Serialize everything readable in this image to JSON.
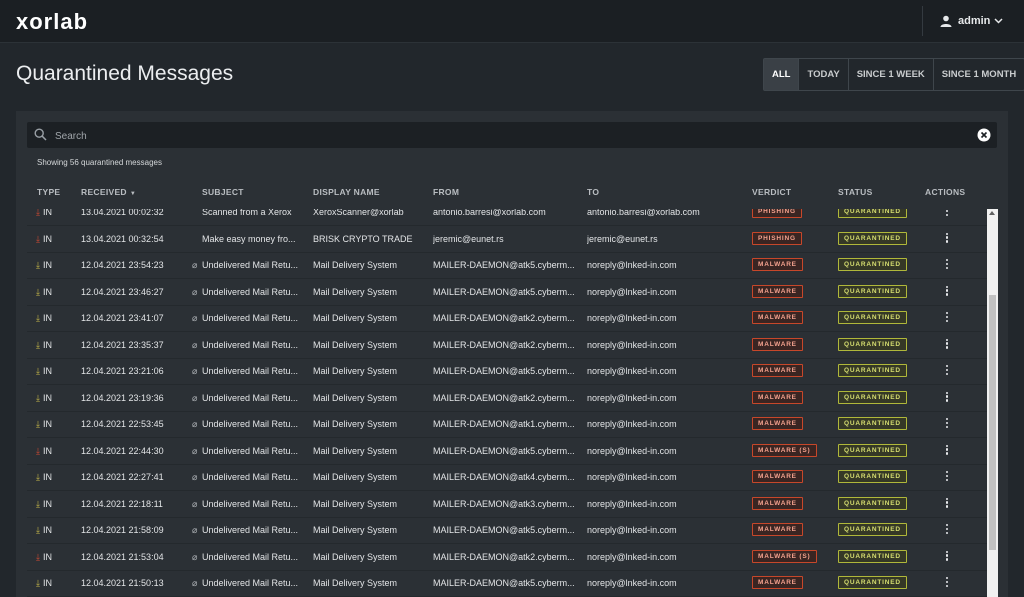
{
  "app": {
    "logo": "xorlab"
  },
  "user": {
    "name": "admin",
    "icon": "user-icon"
  },
  "page": {
    "title": "Quarantined Messages"
  },
  "filters": [
    {
      "label": "ALL",
      "active": true
    },
    {
      "label": "TODAY",
      "active": false
    },
    {
      "label": "SINCE 1 WEEK",
      "active": false
    },
    {
      "label": "SINCE 1 MONTH",
      "active": false
    }
  ],
  "search": {
    "placeholder": "Search",
    "value": ""
  },
  "summary": {
    "text": "Showing 56 quarantined messages"
  },
  "columns": {
    "type": "TYPE",
    "received": "RECEIVED",
    "subject": "SUBJECT",
    "display_name": "DISPLAY NAME",
    "from": "FROM",
    "to": "TO",
    "verdict": "VERDICT",
    "status": "STATUS",
    "actions": "ACTIONS"
  },
  "colors": {
    "arrow_yellow": "#c7b84a",
    "arrow_red": "#d04a32",
    "verdict_border": "#c7472a",
    "status_border": "#b0b83a"
  },
  "rows": [
    {
      "type": "IN",
      "arrow": "red",
      "received": "13.04.2021 00:02:32",
      "attach": false,
      "subject": "Scanned from a Xerox",
      "display_name": "XeroxScanner@xorlab",
      "from": "antonio.barresi@xorlab.com",
      "to": "antonio.barresi@xorlab.com",
      "verdict": "PHISHING",
      "status": "QUARANTINED"
    },
    {
      "type": "IN",
      "arrow": "red",
      "received": "13.04.2021 00:32:54",
      "attach": false,
      "subject": "Make easy money fro...",
      "display_name": "BRISK CRYPTO TRADE",
      "from": "jeremic@eunet.rs",
      "to": "jeremic@eunet.rs",
      "verdict": "PHISHING",
      "status": "QUARANTINED"
    },
    {
      "type": "IN",
      "arrow": "yellow",
      "received": "12.04.2021 23:54:23",
      "attach": true,
      "subject": "Undelivered Mail Retu...",
      "display_name": "Mail Delivery System",
      "from": "MAILER-DAEMON@atk5.cyberm...",
      "to": "noreply@lnked-in.com",
      "verdict": "MALWARE",
      "status": "QUARANTINED"
    },
    {
      "type": "IN",
      "arrow": "yellow",
      "received": "12.04.2021 23:46:27",
      "attach": true,
      "subject": "Undelivered Mail Retu...",
      "display_name": "Mail Delivery System",
      "from": "MAILER-DAEMON@atk5.cyberm...",
      "to": "noreply@lnked-in.com",
      "verdict": "MALWARE",
      "status": "QUARANTINED"
    },
    {
      "type": "IN",
      "arrow": "yellow",
      "received": "12.04.2021 23:41:07",
      "attach": true,
      "subject": "Undelivered Mail Retu...",
      "display_name": "Mail Delivery System",
      "from": "MAILER-DAEMON@atk2.cyberm...",
      "to": "noreply@lnked-in.com",
      "verdict": "MALWARE",
      "status": "QUARANTINED"
    },
    {
      "type": "IN",
      "arrow": "yellow",
      "received": "12.04.2021 23:35:37",
      "attach": true,
      "subject": "Undelivered Mail Retu...",
      "display_name": "Mail Delivery System",
      "from": "MAILER-DAEMON@atk2.cyberm...",
      "to": "noreply@lnked-in.com",
      "verdict": "MALWARE",
      "status": "QUARANTINED"
    },
    {
      "type": "IN",
      "arrow": "yellow",
      "received": "12.04.2021 23:21:06",
      "attach": true,
      "subject": "Undelivered Mail Retu...",
      "display_name": "Mail Delivery System",
      "from": "MAILER-DAEMON@atk5.cyberm...",
      "to": "noreply@lnked-in.com",
      "verdict": "MALWARE",
      "status": "QUARANTINED"
    },
    {
      "type": "IN",
      "arrow": "yellow",
      "received": "12.04.2021 23:19:36",
      "attach": true,
      "subject": "Undelivered Mail Retu...",
      "display_name": "Mail Delivery System",
      "from": "MAILER-DAEMON@atk2.cyberm...",
      "to": "noreply@lnked-in.com",
      "verdict": "MALWARE",
      "status": "QUARANTINED"
    },
    {
      "type": "IN",
      "arrow": "yellow",
      "received": "12.04.2021 22:53:45",
      "attach": true,
      "subject": "Undelivered Mail Retu...",
      "display_name": "Mail Delivery System",
      "from": "MAILER-DAEMON@atk1.cyberm...",
      "to": "noreply@lnked-in.com",
      "verdict": "MALWARE",
      "status": "QUARANTINED"
    },
    {
      "type": "IN",
      "arrow": "red",
      "received": "12.04.2021 22:44:30",
      "attach": true,
      "subject": "Undelivered Mail Retu...",
      "display_name": "Mail Delivery System",
      "from": "MAILER-DAEMON@atk5.cyberm...",
      "to": "noreply@lnked-in.com",
      "verdict": "MALWARE (S)",
      "status": "QUARANTINED"
    },
    {
      "type": "IN",
      "arrow": "yellow",
      "received": "12.04.2021 22:27:41",
      "attach": true,
      "subject": "Undelivered Mail Retu...",
      "display_name": "Mail Delivery System",
      "from": "MAILER-DAEMON@atk4.cyberm...",
      "to": "noreply@lnked-in.com",
      "verdict": "MALWARE",
      "status": "QUARANTINED"
    },
    {
      "type": "IN",
      "arrow": "yellow",
      "received": "12.04.2021 22:18:11",
      "attach": true,
      "subject": "Undelivered Mail Retu...",
      "display_name": "Mail Delivery System",
      "from": "MAILER-DAEMON@atk3.cyberm...",
      "to": "noreply@lnked-in.com",
      "verdict": "MALWARE",
      "status": "QUARANTINED"
    },
    {
      "type": "IN",
      "arrow": "yellow",
      "received": "12.04.2021 21:58:09",
      "attach": true,
      "subject": "Undelivered Mail Retu...",
      "display_name": "Mail Delivery System",
      "from": "MAILER-DAEMON@atk5.cyberm...",
      "to": "noreply@lnked-in.com",
      "verdict": "MALWARE",
      "status": "QUARANTINED"
    },
    {
      "type": "IN",
      "arrow": "red",
      "received": "12.04.2021 21:53:04",
      "attach": true,
      "subject": "Undelivered Mail Retu...",
      "display_name": "Mail Delivery System",
      "from": "MAILER-DAEMON@atk2.cyberm...",
      "to": "noreply@lnked-in.com",
      "verdict": "MALWARE (S)",
      "status": "QUARANTINED"
    },
    {
      "type": "IN",
      "arrow": "yellow",
      "received": "12.04.2021 21:50:13",
      "attach": true,
      "subject": "Undelivered Mail Retu...",
      "display_name": "Mail Delivery System",
      "from": "MAILER-DAEMON@atk5.cyberm...",
      "to": "noreply@lnked-in.com",
      "verdict": "MALWARE",
      "status": "QUARANTINED"
    }
  ]
}
